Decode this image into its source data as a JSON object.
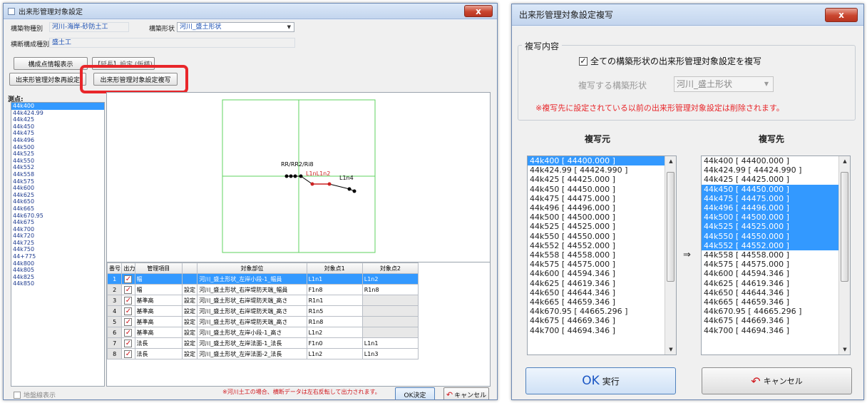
{
  "left_window": {
    "title": "出来形管理対象設定",
    "close_label": "x",
    "structure_type_label": "構築物種別",
    "structure_type_value": "河川-海岸-砂防土工",
    "structure_shape_label": "構築形状",
    "structure_shape_value": "河川_盛土形状",
    "cross_section_label": "横断構成種別",
    "cross_section_value": "盛土工",
    "btn_point_info": "構成点情報表示",
    "btn_extra": "【延長】設定 (仮様)",
    "btn_reset": "出来形管理対象再設定",
    "btn_copy": "出来形管理対象設定複写",
    "measure_label": "測点:",
    "stations": [
      "44k400",
      "44k424.99",
      "44k425",
      "44k450",
      "44k475",
      "44k496",
      "44k500",
      "44k525",
      "44k550",
      "44k552",
      "44k558",
      "44k575",
      "44k600",
      "44k625",
      "44k650",
      "44k665",
      "44k670.95",
      "44k675",
      "44k700",
      "44k720",
      "44k725",
      "44k750",
      "44+775",
      "44k800",
      "44k805",
      "44k825",
      "44k850"
    ],
    "canvas_labels": {
      "rl": "RR/RR2/Ri8",
      "l1n": "L1nL1n2",
      "l1a": "L1n4"
    },
    "table_headers": [
      "番号",
      "出力",
      "管理項目",
      "",
      "対象部位",
      "対象点1",
      "対象点2"
    ],
    "rows": [
      {
        "no": "1",
        "item": "幅",
        "set": "",
        "part": "河川_盛土形状_左岸小段-1_幅員",
        "p1": "L1n1",
        "p2": "L1n2"
      },
      {
        "no": "2",
        "item": "幅",
        "set": "設定",
        "part": "河川_盛土形状_右岸堤防天端_幅員",
        "p1": "F1n8",
        "p2": "R1n8"
      },
      {
        "no": "3",
        "item": "基準高",
        "set": "設定",
        "part": "河川_盛土形状_右岸堤防天端_高さ",
        "p1": "R1n1",
        "p2": ""
      },
      {
        "no": "4",
        "item": "基準高",
        "set": "設定",
        "part": "河川_盛土形状_右岸堤防天端_高さ",
        "p1": "R1n5",
        "p2": ""
      },
      {
        "no": "5",
        "item": "基準高",
        "set": "設定",
        "part": "河川_盛土形状_右岸堤防天端_高さ",
        "p1": "R1n8",
        "p2": ""
      },
      {
        "no": "6",
        "item": "基準高",
        "set": "設定",
        "part": "河川_盛土形状_左岸小段-1_高さ",
        "p1": "L1n2",
        "p2": ""
      },
      {
        "no": "7",
        "item": "法長",
        "set": "設定",
        "part": "河川_盛土形状_左岸法面-1_法長",
        "p1": "F1n0",
        "p2": "L1n1"
      },
      {
        "no": "8",
        "item": "法長",
        "set": "設定",
        "part": "河川_盛土形状_左岸法面-2_法長",
        "p1": "L1n2",
        "p2": "L1n3"
      }
    ],
    "ground_line_label": "地盤線表示",
    "note": "※河川土工の場合、横断データは左右反転して出力されます。",
    "ok_label": "OK決定",
    "cancel_label": "キャンセル"
  },
  "right_window": {
    "title": "出来形管理対象設定複写",
    "close_label": "x",
    "group_label": "複写内容",
    "copy_all_label": "全ての構築形状の出来形管理対象設定を複写",
    "copy_shape_label": "複写する構築形状",
    "copy_shape_value": "河川_盛土形状",
    "warning": "※複写先に設定されている以前の出来形管理対象設定は削除されます。",
    "source_label": "複写元",
    "target_label": "複写先",
    "arrow": "⇒",
    "source_items": [
      "44k400 [ 44400.000 ]",
      "44k424.99 [ 44424.990 ]",
      "44k425 [ 44425.000 ]",
      "44k450 [ 44450.000 ]",
      "44k475 [ 44475.000 ]",
      "44k496 [ 44496.000 ]",
      "44k500 [ 44500.000 ]",
      "44k525 [ 44525.000 ]",
      "44k550 [ 44550.000 ]",
      "44k552 [ 44552.000 ]",
      "44k558 [ 44558.000 ]",
      "44k575 [ 44575.000 ]",
      "44k600 [ 44594.346 ]",
      "44k625 [ 44619.346 ]",
      "44k650 [ 44644.346 ]",
      "44k665 [ 44659.346 ]",
      "44k670.95 [ 44665.296 ]",
      "44k675 [ 44669.346 ]",
      "44k700 [ 44694.346 ]"
    ],
    "source_selected": [
      0
    ],
    "target_items": [
      "44k400 [ 44400.000 ]",
      "44k424.99 [ 44424.990 ]",
      "44k425 [ 44425.000 ]",
      "44k450 [ 44450.000 ]",
      "44k475 [ 44475.000 ]",
      "44k496 [ 44496.000 ]",
      "44k500 [ 44500.000 ]",
      "44k525 [ 44525.000 ]",
      "44k550 [ 44550.000 ]",
      "44k552 [ 44552.000 ]",
      "44k558 [ 44558.000 ]",
      "44k575 [ 44575.000 ]",
      "44k600 [ 44594.346 ]",
      "44k625 [ 44619.346 ]",
      "44k650 [ 44644.346 ]",
      "44k665 [ 44659.346 ]",
      "44k670.95 [ 44665.296 ]",
      "44k675 [ 44669.346 ]",
      "44k700 [ 44694.346 ]"
    ],
    "target_selected": [
      3,
      4,
      5,
      6,
      7,
      8,
      9
    ],
    "ok_big": "OK",
    "ok_small": "実行",
    "cancel_label": "キャンセル"
  },
  "colors": {
    "highlight": "#e8262a",
    "selection": "#3399ff",
    "grid_green": "#5fd35f",
    "link_blue": "#1a4fb3"
  }
}
